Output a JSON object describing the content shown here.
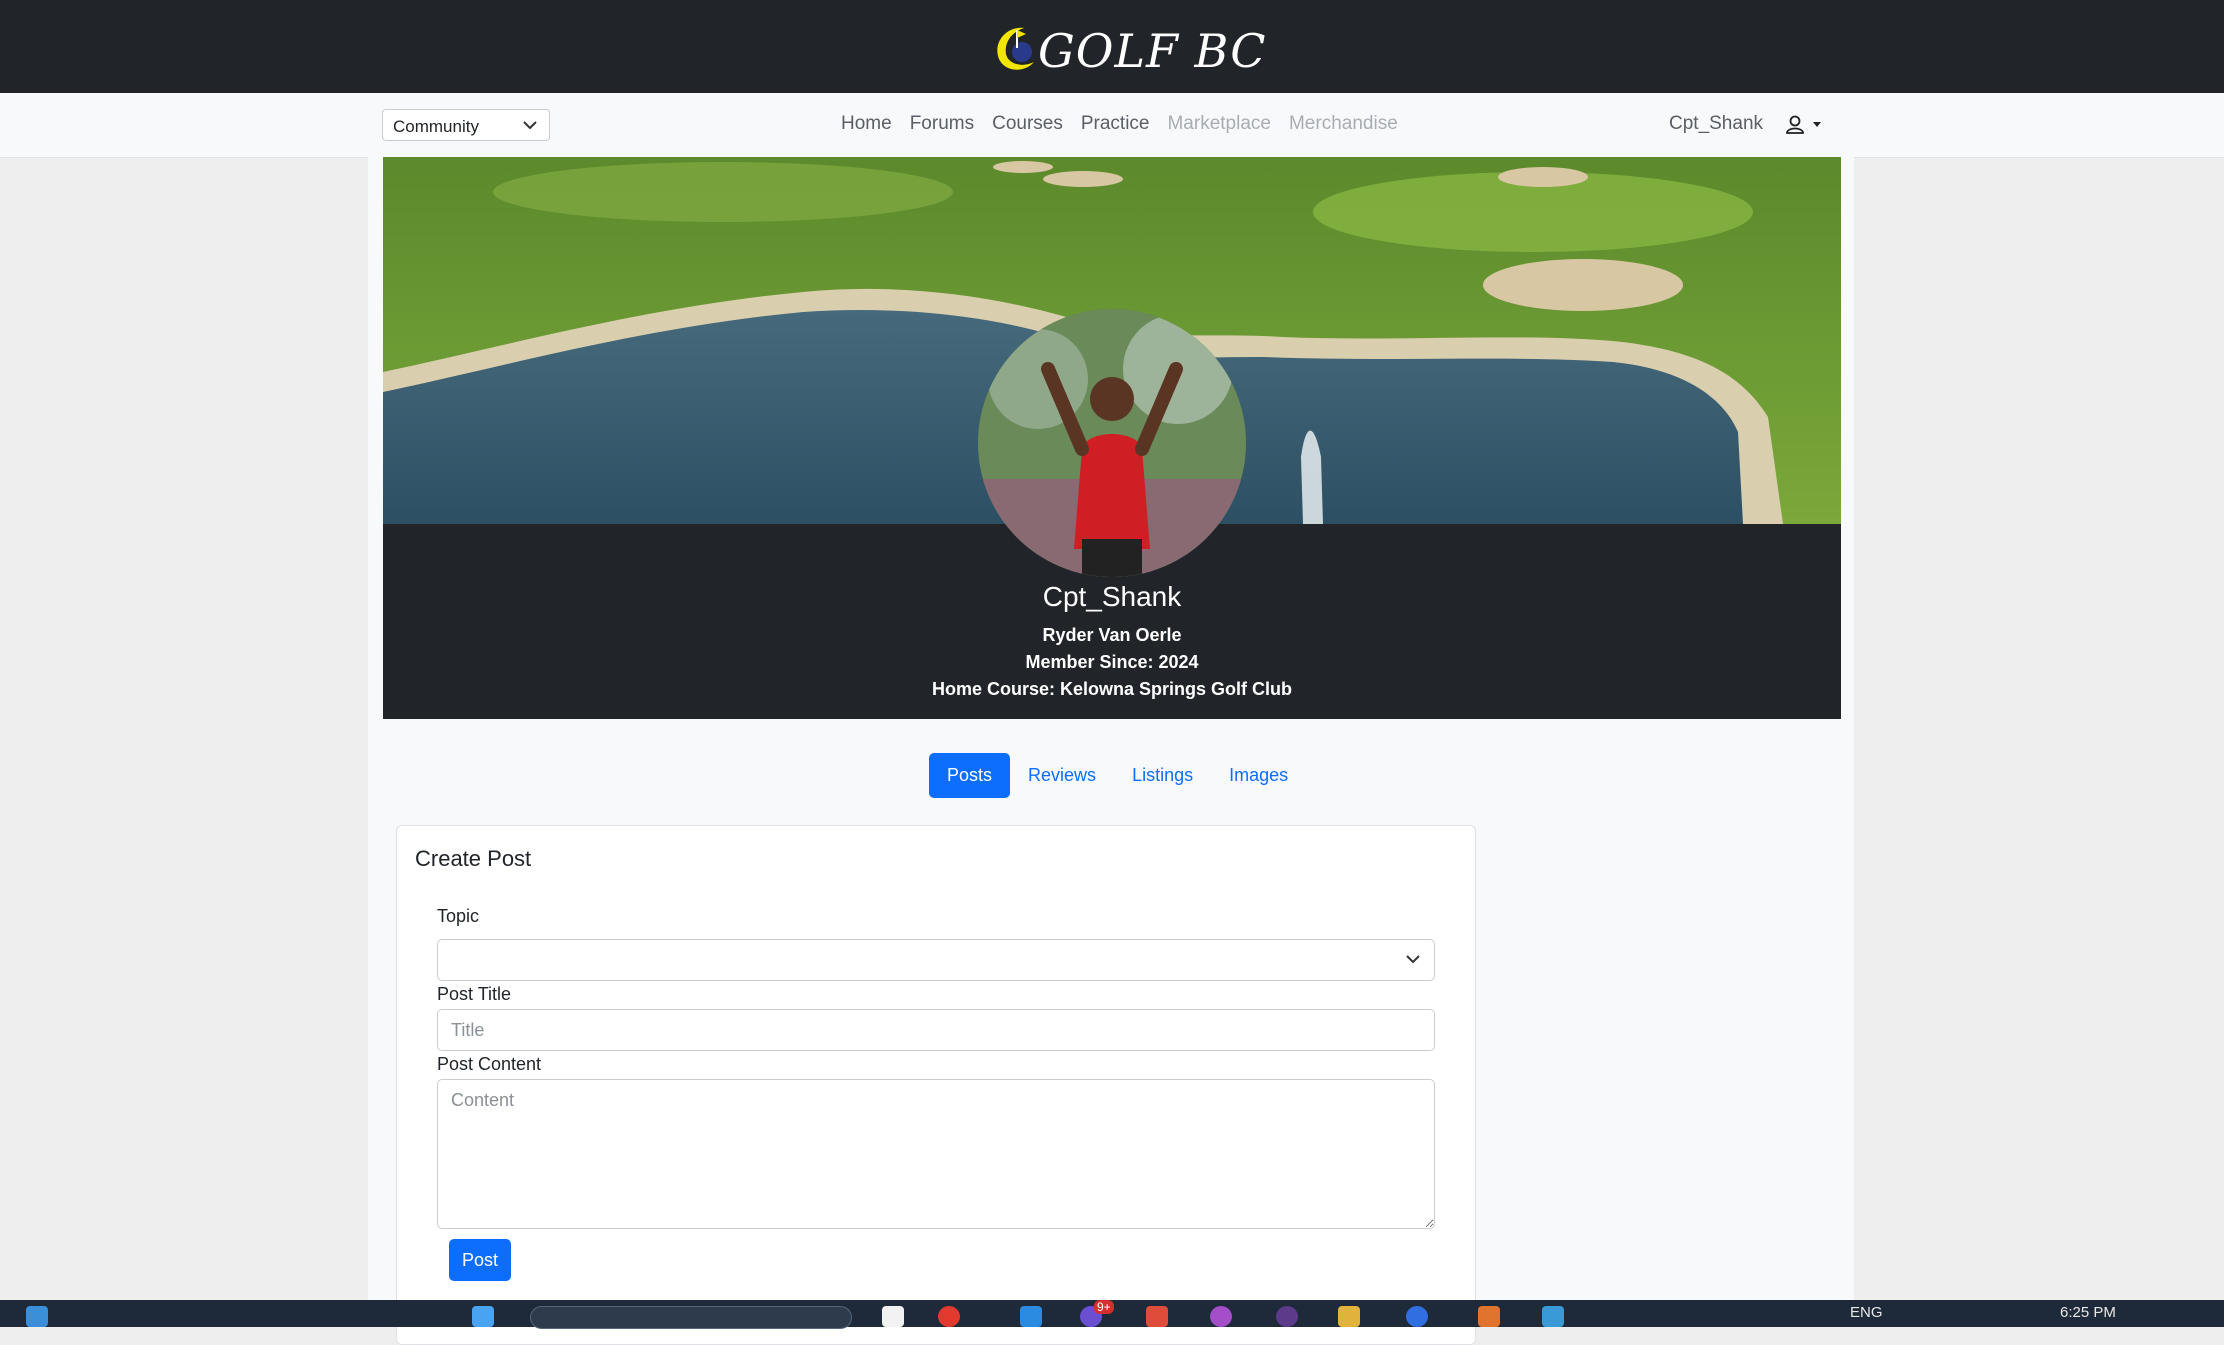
{
  "brand": {
    "logo_text": "GOLF BC"
  },
  "nav": {
    "community_select": "Community",
    "links": [
      "Home",
      "Forums",
      "Courses",
      "Practice",
      "Marketplace",
      "Merchandise"
    ],
    "username": "Cpt_Shank"
  },
  "profile": {
    "username": "Cpt_Shank",
    "full_name": "Ryder Van Oerle",
    "member_since": "Member Since: 2024",
    "home_course": "Home Course: Kelowna Springs Golf Club"
  },
  "tabs": [
    "Posts",
    "Reviews",
    "Listings",
    "Images"
  ],
  "create_post": {
    "title": "Create Post",
    "topic_label": "Topic",
    "post_title_label": "Post Title",
    "post_title_placeholder": "Title",
    "post_content_label": "Post Content",
    "post_content_placeholder": "Content",
    "submit_label": "Post"
  },
  "taskbar": {
    "language": "ENG",
    "time": "6:25 PM",
    "badge": "9+"
  },
  "colors": {
    "brand_bar": "#212529",
    "primary": "#0d6efd",
    "nav_bg": "#f8f9fa",
    "logo_yellow": "#f2e600"
  }
}
